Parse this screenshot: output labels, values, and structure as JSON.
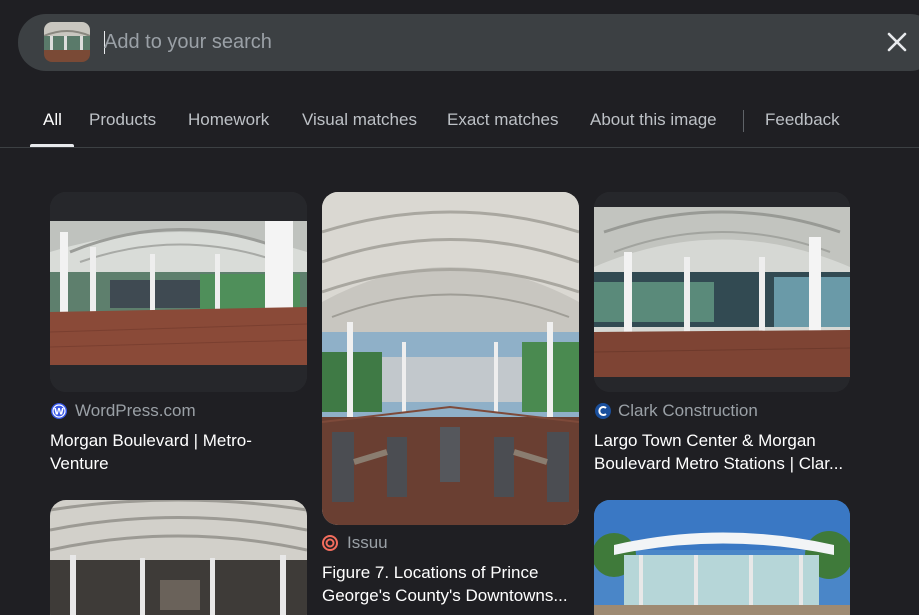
{
  "search": {
    "placeholder": "Add to your search",
    "query_thumbnail": "station-canopy-thumbnail",
    "close_icon": "close-icon"
  },
  "tabs": [
    {
      "label": "All",
      "active": true
    },
    {
      "label": "Products"
    },
    {
      "label": "Homework"
    },
    {
      "label": "Visual matches"
    },
    {
      "label": "Exact matches"
    },
    {
      "label": "About this image"
    },
    {
      "label": "Feedback"
    }
  ],
  "results": [
    {
      "source": "WordPress.com",
      "favicon": "wordpress-icon",
      "title": "Morgan Boulevard | Metro-Venture"
    },
    {
      "source": "Issuu",
      "favicon": "issuu-icon",
      "title": "Figure 7. Locations of Prince George's County's Downtowns..."
    },
    {
      "source": "Clark Construction",
      "favicon": "clark-construction-icon",
      "title": "Largo Town Center & Morgan Boulevard Metro Stations | Clar..."
    }
  ],
  "colors": {
    "background": "#1f1f23",
    "search_bar": "#3c4043",
    "active_tab": "#ffffff",
    "inactive_tab": "#bdc1c6"
  }
}
